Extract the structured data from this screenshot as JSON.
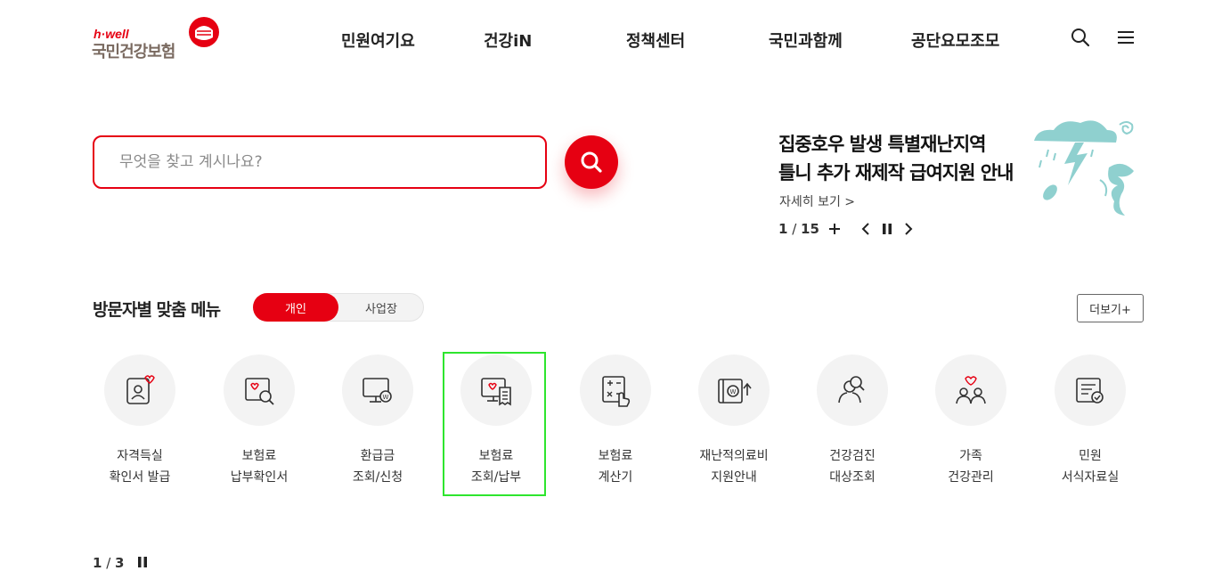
{
  "logo": {
    "tagline": "h·well",
    "name": "국민건강보험"
  },
  "nav": [
    {
      "label": "민원여기요"
    },
    {
      "label": "건강iN"
    },
    {
      "label": "정책센터"
    },
    {
      "label": "국민과함께"
    },
    {
      "label": "공단요모조모"
    }
  ],
  "header_icons": {
    "search": "search-icon",
    "menu": "hamburger-menu-icon"
  },
  "search": {
    "placeholder": "무엇을 찾고 계시나요?",
    "value": ""
  },
  "notice": {
    "title_line1": "집중호우 발생 특별재난지역",
    "title_line2": "틀니 추가 재제작 급여지원 안내",
    "more_label": "자세히 보기 >",
    "current": "1",
    "total": "15"
  },
  "menu_section": {
    "title": "방문자별 맞춤 메뉴",
    "tabs": [
      {
        "label": "개인",
        "active": true
      },
      {
        "label": "사업장",
        "active": false
      }
    ],
    "more_label": "더보기+",
    "items": [
      {
        "line1": "자격득실",
        "line2": "확인서 발급",
        "icon": "id-card-heart-icon"
      },
      {
        "line1": "보험료",
        "line2": "납부확인서",
        "icon": "document-search-icon"
      },
      {
        "line1": "환급금",
        "line2": "조회/신청",
        "icon": "monitor-won-icon"
      },
      {
        "line1": "보험료",
        "line2": "조회/납부",
        "icon": "monitor-receipt-icon"
      },
      {
        "line1": "보험료",
        "line2": "계산기",
        "icon": "calculator-hand-icon"
      },
      {
        "line1": "재난적의료비",
        "line2": "지원안내",
        "icon": "wallet-won-icon"
      },
      {
        "line1": "건강검진",
        "line2": "대상조회",
        "icon": "person-search-icon"
      },
      {
        "line1": "가족",
        "line2": "건강관리",
        "icon": "family-heart-icon"
      },
      {
        "line1": "민원",
        "line2": "서식자료실",
        "icon": "form-check-icon"
      }
    ],
    "pager_current": "1",
    "pager_total": "3"
  },
  "colors": {
    "brand": "#e60012",
    "highlight": "#2ee52e",
    "icon_bg": "#f3f3f3",
    "illustration": "#8fd0cf"
  }
}
